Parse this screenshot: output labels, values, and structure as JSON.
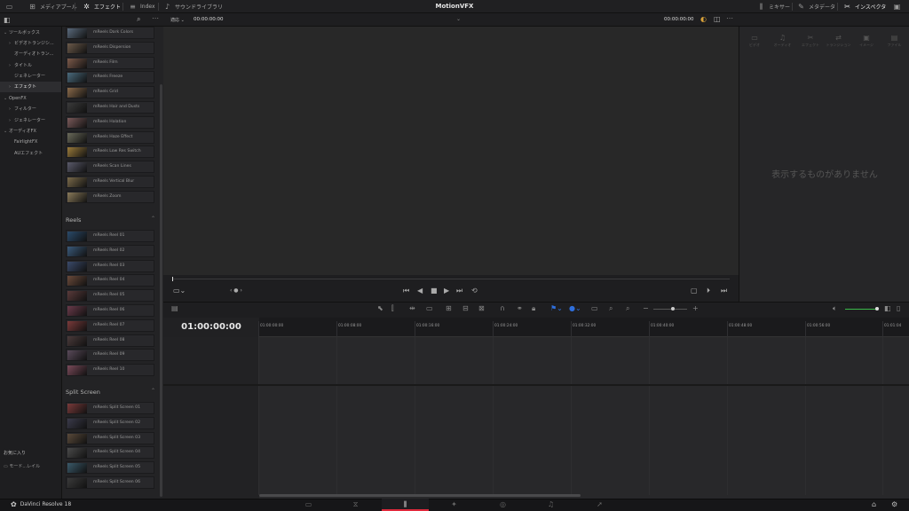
{
  "app": {
    "title": "MotionVFX",
    "brand": "DaVinci Resolve 18"
  },
  "topbar": {
    "items": [
      {
        "label": "メディアプール",
        "icon": "media-pool-icon"
      },
      {
        "label": "エフェクト",
        "icon": "effects-icon"
      },
      {
        "label": "Index",
        "icon": "index-icon"
      },
      {
        "label": "サウンドライブラリ",
        "icon": "sound-library-icon"
      },
      {
        "label": "ミキサー",
        "icon": "mixer-icon"
      },
      {
        "label": "メタデータ",
        "icon": "metadata-icon"
      },
      {
        "label": "インスペクタ",
        "icon": "inspector-icon"
      }
    ]
  },
  "subbar": {
    "zoom": "適応",
    "timecode_left": "00:00:00:00",
    "timecode_right": "00:00:00:00"
  },
  "tree": {
    "items": [
      {
        "label": "ツールボックス",
        "caret": "v",
        "indent": 0
      },
      {
        "label": "ビデオトランジシ...",
        "caret": ">",
        "indent": 1
      },
      {
        "label": "オーディオトラン...",
        "caret": "",
        "indent": 1
      },
      {
        "label": "タイトル",
        "caret": ">",
        "indent": 1
      },
      {
        "label": "ジェネレーター",
        "caret": "",
        "indent": 1
      },
      {
        "label": "エフェクト",
        "caret": ">",
        "indent": 1,
        "selected": true
      },
      {
        "label": "OpenFX",
        "caret": "v",
        "indent": 0
      },
      {
        "label": "フィルター",
        "caret": ">",
        "indent": 1
      },
      {
        "label": "ジェネレーター",
        "caret": ">",
        "indent": 1
      },
      {
        "label": "オーディオFX",
        "caret": "v",
        "indent": 0
      },
      {
        "label": "FairlightFX",
        "caret": "",
        "indent": 1
      },
      {
        "label": "AUエフェクト",
        "caret": "",
        "indent": 1
      }
    ]
  },
  "effects": {
    "group1": [
      {
        "label": "mReels Dark Colors",
        "color": "#5a6a7c"
      },
      {
        "label": "mReels Dispersion",
        "color": "#6b5a4a"
      },
      {
        "label": "mReels Film",
        "color": "#7c5a4a"
      },
      {
        "label": "mReels Freeze",
        "color": "#4a6a7c"
      },
      {
        "label": "mReels Grid",
        "color": "#8a6a4a"
      },
      {
        "label": "mReels Hair and Dusts",
        "color": "#3a3a3a"
      },
      {
        "label": "mReels Halation",
        "color": "#7a5a5a"
      },
      {
        "label": "mReels Haze Effect",
        "color": "#6a6a5a"
      },
      {
        "label": "mReels Low Res Switch",
        "color": "#9a7a3a"
      },
      {
        "label": "mReels Scan Lines",
        "color": "#5a5a6a"
      },
      {
        "label": "mReels Vertical Blur",
        "color": "#7a6a4a"
      },
      {
        "label": "mReels Zoom",
        "color": "#8a7a5a"
      }
    ],
    "reels_header": "Reels",
    "reels": [
      {
        "label": "mReels Reel 01",
        "color": "#2a4a6a"
      },
      {
        "label": "mReels Reel 02",
        "color": "#3a5a7a"
      },
      {
        "label": "mReels Reel 03",
        "color": "#3a4a6a"
      },
      {
        "label": "mReels Reel 04",
        "color": "#6a4a3a"
      },
      {
        "label": "mReels Reel 05",
        "color": "#5a3a3a"
      },
      {
        "label": "mReels Reel 06",
        "color": "#6a3a4a"
      },
      {
        "label": "mReels Reel 07",
        "color": "#7a3a3a"
      },
      {
        "label": "mReels Reel 08",
        "color": "#4a3a3a"
      },
      {
        "label": "mReels Reel 09",
        "color": "#5a4a5a"
      },
      {
        "label": "mReels Reel 10",
        "color": "#7a4a5a"
      }
    ],
    "split_header": "Split Screen",
    "split": [
      {
        "label": "mReels Split Screen 01",
        "color": "#7a3a3a"
      },
      {
        "label": "mReels Split Screen 02",
        "color": "#3a3a4a"
      },
      {
        "label": "mReels Split Screen 03",
        "color": "#5a4a3a"
      },
      {
        "label": "mReels Split Screen 04",
        "color": "#4a4a4a"
      },
      {
        "label": "mReels Split Screen 05",
        "color": "#3a5a6a"
      },
      {
        "label": "mReels Split Screen 06",
        "color": "#3a3a3a"
      }
    ]
  },
  "inspector": {
    "tabs": [
      "ビデオ",
      "オーディオ",
      "エフェクト",
      "トランジション",
      "イメージ",
      "ファイル"
    ],
    "empty_message": "表示するものがありません"
  },
  "timeline": {
    "timecode": "01:00:00:00",
    "ticks": [
      "01:00:00:00",
      "01:00:08:00",
      "01:00:16:00",
      "01:00:24:00",
      "01:00:32:00",
      "01:00:40:00",
      "01:00:48:00",
      "01:00:56:00",
      "01:01:04"
    ],
    "volume": 0.7
  },
  "favorites": {
    "title": "お気に入り",
    "item": "モード...レイル"
  },
  "pages": [
    "media",
    "cut",
    "edit",
    "fusion",
    "color",
    "fairlight",
    "deliver"
  ],
  "colors": {
    "accent": "#e0293b",
    "volume": "#3bb94a",
    "flag": "#2f6fdc"
  }
}
